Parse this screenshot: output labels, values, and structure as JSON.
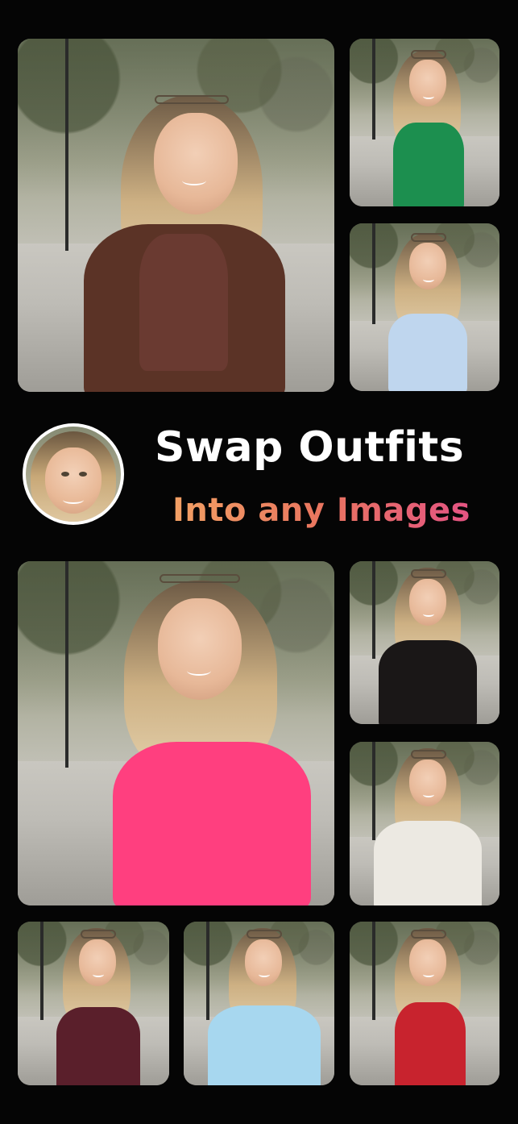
{
  "headline": {
    "line1": "Swap Outfits",
    "line2": "Into any Images"
  },
  "colors": {
    "background": "#050505",
    "headline_primary": "#ffffff",
    "gradient_start": "#f2a064",
    "gradient_mid": "#e9765f",
    "gradient_end": "#e34e88"
  },
  "photos": [
    {
      "name": "brown-blazer-outfit",
      "outfit_color": "#5b3326"
    },
    {
      "name": "green-sequin-dress",
      "outfit_color": "#1c8f4f"
    },
    {
      "name": "light-blue-corset-top",
      "outfit_color": "#bfd6ee"
    },
    {
      "name": "pink-one-shoulder-dress",
      "outfit_color": "#ff3f7f"
    },
    {
      "name": "black-lace-top",
      "outfit_color": "#1a1717"
    },
    {
      "name": "white-cardigan",
      "outfit_color": "#ece9e2"
    },
    {
      "name": "floral-burgundy-dress",
      "outfit_color": "#5a1f2b"
    },
    {
      "name": "light-blue-ruffle-top",
      "outfit_color": "#a7d7ef"
    },
    {
      "name": "red-dress",
      "outfit_color": "#c8232e"
    }
  ]
}
